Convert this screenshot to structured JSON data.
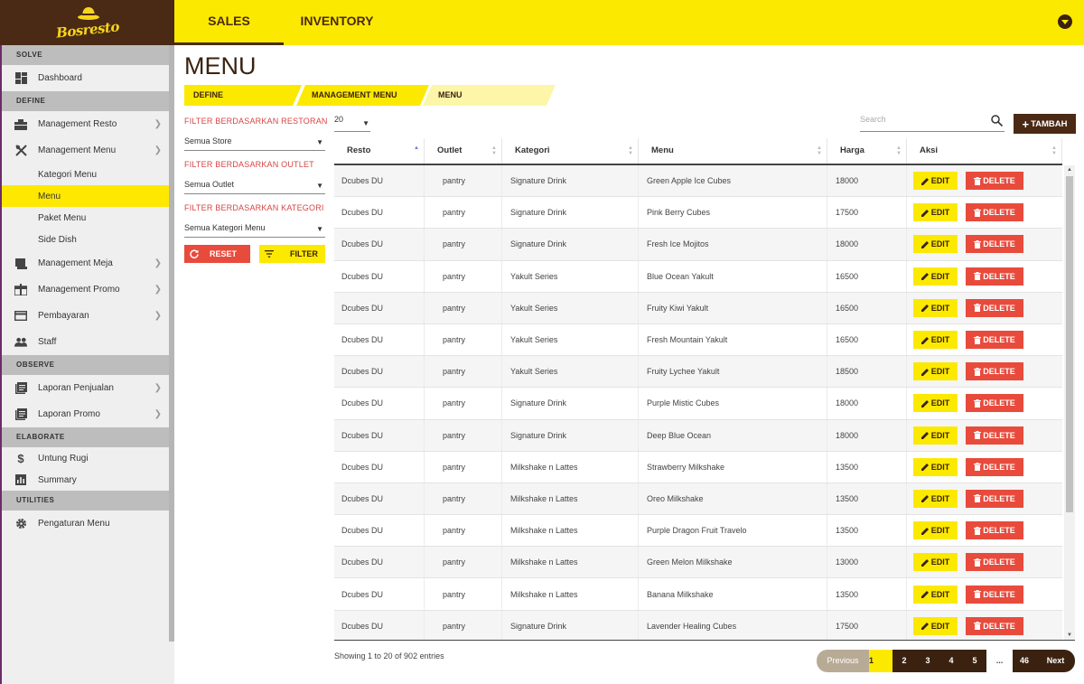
{
  "brand": {
    "logo_text": "Bosresto"
  },
  "topnav": {
    "tabs": [
      "SALES",
      "INVENTORY"
    ],
    "active_tab": "SALES"
  },
  "sidebar": {
    "solve": {
      "title": "SOLVE",
      "items": [
        {
          "label": "Dashboard",
          "icon": "dashboard-icon"
        }
      ]
    },
    "define": {
      "title": "DEFINE",
      "items": [
        {
          "label": "Management Resto",
          "icon": "restaurant-icon"
        },
        {
          "label": "Management Menu",
          "icon": "cutlery-icon"
        }
      ],
      "subitems": [
        "Kategori Menu",
        "Menu",
        "Paket Menu",
        "Side Dish"
      ],
      "active_subitem": "Menu",
      "items2": [
        {
          "label": "Management Meja",
          "icon": "table-icon"
        },
        {
          "label": "Management Promo",
          "icon": "gift-icon"
        },
        {
          "label": "Pembayaran",
          "icon": "card-icon"
        },
        {
          "label": "Staff",
          "icon": "people-icon"
        }
      ]
    },
    "observe": {
      "title": "OBSERVE",
      "items": [
        {
          "label": "Laporan Penjualan",
          "icon": "report-icon"
        },
        {
          "label": "Laporan Promo",
          "icon": "report-icon"
        }
      ]
    },
    "elaborate": {
      "title": "ELABORATE",
      "items": [
        {
          "label": "Untung Rugi",
          "icon": "dollar-icon"
        },
        {
          "label": "Summary",
          "icon": "bar-chart-icon"
        }
      ]
    },
    "utilities": {
      "title": "UTILITIES",
      "items": [
        {
          "label": "Pengaturan Menu",
          "icon": "gear-icon"
        }
      ]
    }
  },
  "page": {
    "title": "MENU",
    "breadcrumbs": [
      "DEFINE",
      "MANAGEMENT MENU",
      "MENU"
    ]
  },
  "filters": {
    "restoran": {
      "label": "FILTER BERDASARKAN RESTORAN",
      "value": "Semua Store"
    },
    "outlet": {
      "label": "FILTER BERDASARKAN OUTLET",
      "value": "Semua Outlet"
    },
    "kategori": {
      "label": "FILTER BERDASARKAN KATEGORI",
      "value": "Semua Kategori Menu"
    },
    "reset_label": "RESET",
    "filter_label": "FILTER"
  },
  "table_controls": {
    "page_length": "20",
    "search_placeholder": "Search",
    "add_label": "TAMBAH"
  },
  "table": {
    "columns": [
      "Resto",
      "Outlet",
      "Kategori",
      "Menu",
      "Harga",
      "Aksi"
    ],
    "edit_label": "EDIT",
    "delete_label": "DELETE",
    "rows": [
      [
        "Dcubes DU",
        "pantry",
        "Signature Drink",
        "Green Apple Ice Cubes",
        "18000"
      ],
      [
        "Dcubes DU",
        "pantry",
        "Signature Drink",
        "Pink Berry Cubes",
        "17500"
      ],
      [
        "Dcubes DU",
        "pantry",
        "Signature Drink",
        "Fresh Ice Mojitos",
        "18000"
      ],
      [
        "Dcubes DU",
        "pantry",
        "Yakult Series",
        "Blue Ocean Yakult",
        "16500"
      ],
      [
        "Dcubes DU",
        "pantry",
        "Yakult Series",
        "Fruity Kiwi Yakult",
        "16500"
      ],
      [
        "Dcubes DU",
        "pantry",
        "Yakult Series",
        "Fresh Mountain Yakult",
        "16500"
      ],
      [
        "Dcubes DU",
        "pantry",
        "Yakult Series",
        "Fruity Lychee Yakult",
        "18500"
      ],
      [
        "Dcubes DU",
        "pantry",
        "Signature Drink",
        "Purple Mistic Cubes",
        "18000"
      ],
      [
        "Dcubes DU",
        "pantry",
        "Signature Drink",
        "Deep Blue Ocean",
        "18000"
      ],
      [
        "Dcubes DU",
        "pantry",
        "Milkshake n Lattes",
        "Strawberry Milkshake",
        "13500"
      ],
      [
        "Dcubes DU",
        "pantry",
        "Milkshake n Lattes",
        "Oreo Milkshake",
        "13500"
      ],
      [
        "Dcubes DU",
        "pantry",
        "Milkshake n Lattes",
        "Purple Dragon Fruit Travelo",
        "13500"
      ],
      [
        "Dcubes DU",
        "pantry",
        "Milkshake n Lattes",
        "Green Melon Milkshake",
        "13000"
      ],
      [
        "Dcubes DU",
        "pantry",
        "Milkshake n Lattes",
        "Banana Milkshake",
        "13500"
      ],
      [
        "Dcubes DU",
        "pantry",
        "Signature Drink",
        "Lavender Healing Cubes",
        "17500"
      ]
    ]
  },
  "footer": {
    "info": "Showing 1 to 20 of 902 entries",
    "pager": {
      "previous": "Previous",
      "pages": [
        "1",
        "2",
        "3",
        "4",
        "5"
      ],
      "ellipsis": "...",
      "last": "46",
      "next": "Next",
      "current": "1"
    }
  },
  "colors": {
    "yellow": "#fce900",
    "brown": "#4a2a14",
    "red": "#e84b3c"
  }
}
